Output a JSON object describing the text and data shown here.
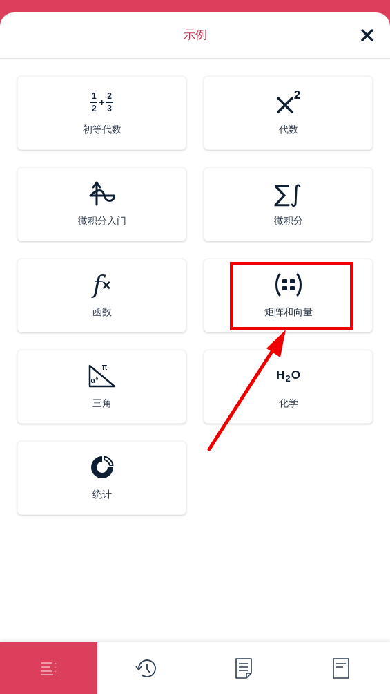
{
  "sheet": {
    "title": "示例"
  },
  "card_rows": [
    [
      {
        "label": "初等代数",
        "icon": {
          "kind": "fractions",
          "glyphs": [
            "1",
            "2",
            "+",
            "2",
            "3"
          ]
        }
      },
      {
        "label": "代数",
        "icon": {
          "kind": "power",
          "glyphs": [
            "2"
          ]
        }
      }
    ],
    [
      {
        "label": "微积分入门",
        "icon": {
          "kind": "graph"
        }
      },
      {
        "label": "微积分",
        "icon": {
          "kind": "symbols",
          "glyphs": [
            "∑∫"
          ]
        }
      }
    ],
    [
      {
        "label": "函数",
        "icon": {
          "kind": "function",
          "glyphs": [
            "f",
            "×"
          ]
        }
      },
      {
        "label": "矩阵和向量",
        "icon": {
          "kind": "matrix"
        }
      }
    ],
    [
      {
        "label": "三角",
        "icon": {
          "kind": "triangle",
          "glyphs": [
            "π",
            "α°"
          ]
        }
      },
      {
        "label": "化学",
        "icon": {
          "kind": "formula",
          "glyphs": [
            "H",
            "2",
            "O"
          ]
        }
      }
    ],
    [
      {
        "label": "统计",
        "icon": {
          "kind": "donut"
        }
      }
    ]
  ],
  "tab_bar": [
    {
      "kind": "list",
      "selected": true
    },
    {
      "kind": "history",
      "selected": false
    },
    {
      "kind": "document",
      "selected": false
    },
    {
      "kind": "page",
      "selected": false
    }
  ]
}
